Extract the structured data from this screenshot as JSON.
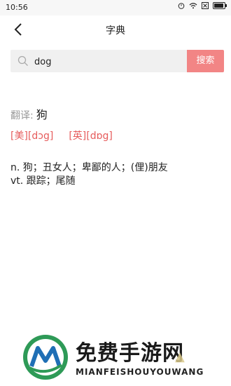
{
  "status_bar": {
    "time": "10:56",
    "battery_level": 0.9
  },
  "nav": {
    "title": "字典"
  },
  "search": {
    "value": "dog",
    "button_label": "搜索"
  },
  "result": {
    "translation_label": "翻译:",
    "translation_value": "狗",
    "phonetic_us": "[美][dɔg]",
    "phonetic_uk": "[英][dɒg]",
    "definitions": [
      "n. 狗；丑女人；卑鄙的人；(俚)朋友",
      "vt. 跟踪；尾随"
    ]
  },
  "watermark": {
    "title": "免费手游网",
    "subtitle": "MIANFEISHOUYOUWANG"
  },
  "colors": {
    "accent": "#f28585",
    "phonetic": "#e65c5c",
    "logo_green": "#2e9a57"
  }
}
